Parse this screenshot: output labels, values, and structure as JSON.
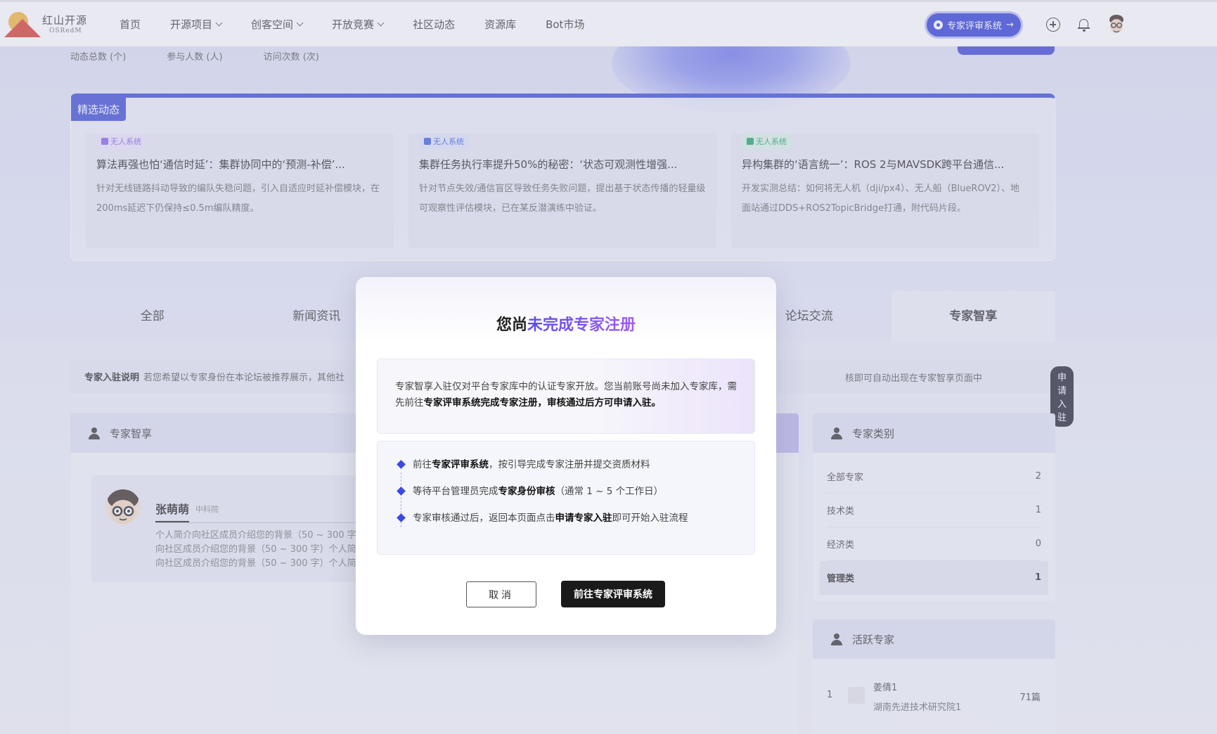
{
  "header": {
    "logo_cn": "红山开源",
    "logo_en": "OSRedM",
    "nav": [
      {
        "label": "首页",
        "dropdown": false
      },
      {
        "label": "开源项目",
        "dropdown": true
      },
      {
        "label": "创客空间",
        "dropdown": true
      },
      {
        "label": "开放竞赛",
        "dropdown": true
      },
      {
        "label": "社区动态",
        "dropdown": false
      },
      {
        "label": "资源库",
        "dropdown": false
      },
      {
        "label": "Bot市场",
        "dropdown": false
      }
    ],
    "expert_system_button": "专家评审系统",
    "expert_system_arrow": "→"
  },
  "stats": {
    "labels": [
      "动态总数 (个)",
      "参与人数 (人)",
      "访问次数 (次)"
    ]
  },
  "featured": {
    "tag": "精选动态",
    "cards": [
      {
        "badge": "无人系统",
        "badge_color": "#8a5cf0",
        "title": "算法再强也怕‘通信时延’：集群协同中的‘预测-补偿’...",
        "desc": "针对无线链路抖动导致的编队失稳问题，引入自适应时延补偿模块，在200ms延迟下仍保持≤0.5m编队精度。"
      },
      {
        "badge": "无人系统",
        "badge_color": "#3b5ce0",
        "title": "集群任务执行率提升50%的秘密：‘状态可观测性增强...",
        "desc": "针对节点失效/通信盲区导致任务失败问题，提出基于状态传播的轻量级可观察性评估模块，已在某反潜演练中验证。"
      },
      {
        "badge": "无人系统",
        "badge_color": "#1ba36a",
        "title": "异构集群的‘语言统一’：ROS 2与MAVSDK跨平台通信...",
        "desc": "开发实测总结：如何将无人机（dji/px4）、无人船（BlueROV2）、地面站通过DDS+ROS2TopicBridge打通，附代码片段。"
      }
    ]
  },
  "tabs": [
    {
      "label": "全部",
      "active": false
    },
    {
      "label": "新闻资讯",
      "active": false
    },
    {
      "label": "",
      "active": false
    },
    {
      "label": "",
      "active": false
    },
    {
      "label": "论坛交流",
      "active": false
    },
    {
      "label": "专家智享",
      "active": true
    }
  ],
  "notice": {
    "title": "专家入驻说明",
    "text_left": "若您希望以专家身份在本论坛被推荐展示，其他社",
    "text_right": "核即可自动出现在专家智享页面中",
    "apply_button": "申请入驻"
  },
  "expert_panel": {
    "title": "专家智享",
    "expert": {
      "name": "张萌萌",
      "org": "中科院",
      "bio": "个人简介向社区成员介绍您的背景（50 ~ 300 字）向社区成员介绍您的背景（50 ~ 300 字）个人简介向社区成员介绍您的背景（50 ~ 300 字）个人简介向社区"
    }
  },
  "category_panel": {
    "title": "专家类别",
    "items": [
      {
        "label": "全部专家",
        "count": "2",
        "active": false
      },
      {
        "label": "技术类",
        "count": "1",
        "active": false
      },
      {
        "label": "经济类",
        "count": "0",
        "active": false
      },
      {
        "label": "管理类",
        "count": "1",
        "active": true
      }
    ]
  },
  "active_panel": {
    "title": "活跃专家",
    "items": [
      {
        "rank": "1",
        "name": "姜倩1",
        "org": "湖南先进技术研究院1",
        "posts": "71篇"
      }
    ]
  },
  "modal": {
    "title_prefix": "您尚",
    "title_highlight": "未完成专家注册",
    "info_plain_1": "专家智享入驻仅对平台专家库中的认证专家开放。您当前账号尚未加入专家库，需先前往",
    "info_bold": "专家评审系统完成专家注册，审核通过后方可申请入驻。",
    "steps": [
      {
        "pre": "前往",
        "bold": "专家评审系统",
        "post": "，按引导完成专家注册并提交资质材料"
      },
      {
        "pre": "等待平台管理员完成",
        "bold": "专家身份审核",
        "post": "（通常 1 ~ 5 个工作日）"
      },
      {
        "pre": "专家审核通过后，返回本页面点击",
        "bold": "申请专家入驻",
        "post": "即可开始入驻流程"
      }
    ],
    "cancel_button": "取消",
    "go_button": "前往专家评审系统"
  }
}
